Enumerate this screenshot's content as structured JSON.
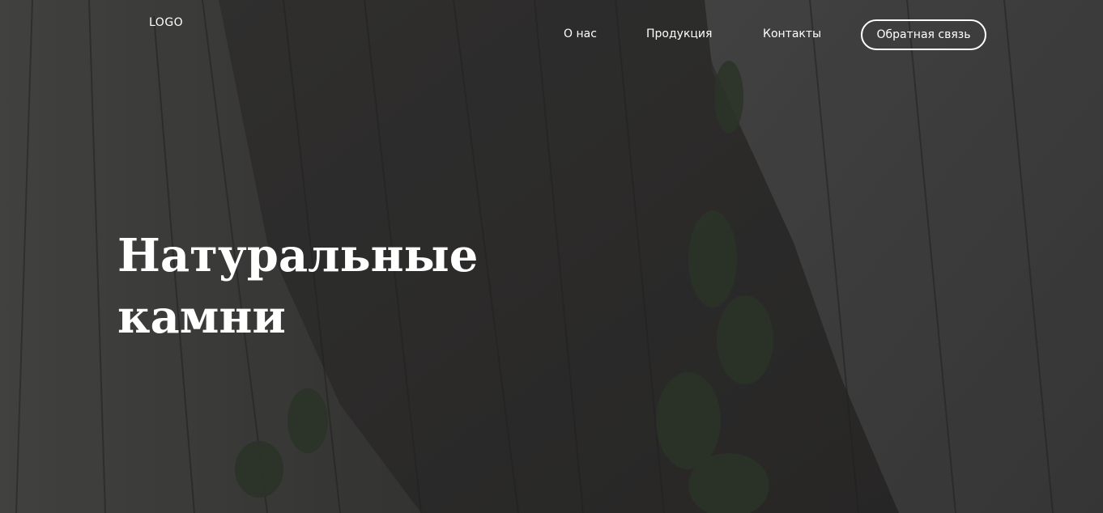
{
  "header": {
    "logo": "LOGO",
    "nav": [
      {
        "label": "О нас"
      },
      {
        "label": "Продукция"
      },
      {
        "label": "Контакты"
      }
    ],
    "cta_label": "Обратная связь"
  },
  "hero": {
    "title_line1": "Натуральные",
    "title_line2": "камни",
    "background": "dark granite cliff photo"
  },
  "colors": {
    "text": "#ffffff",
    "overlay": "#1e1e1e"
  }
}
